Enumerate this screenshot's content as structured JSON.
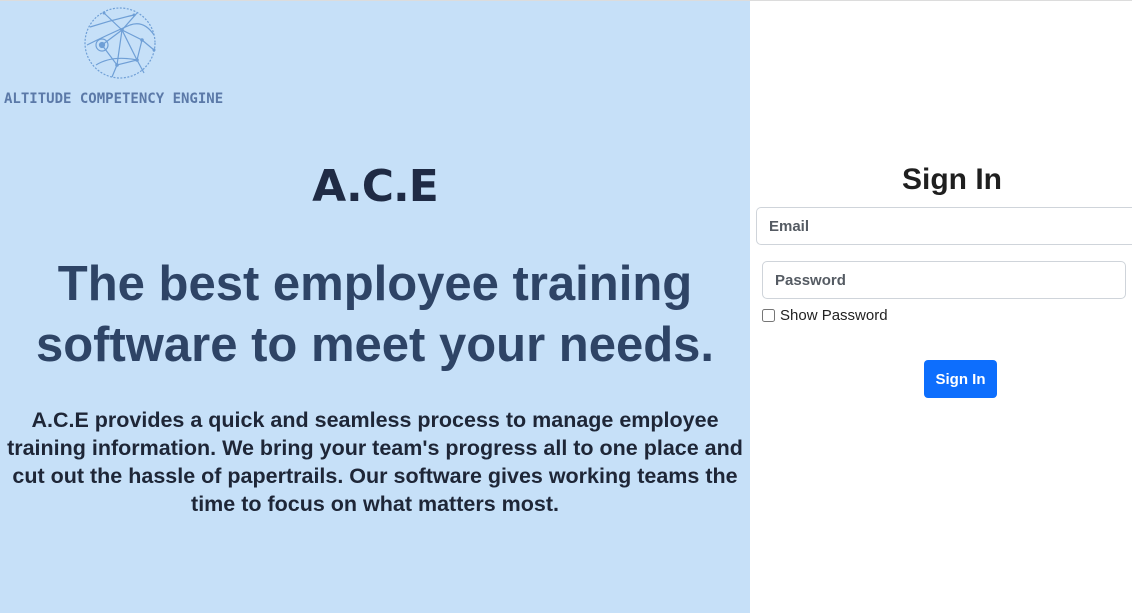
{
  "hero": {
    "logo_text": "ALTITUDE COMPETENCY ENGINE",
    "brand": "A.C.E",
    "headline_line1": "The best employee training",
    "headline_line2": "software to meet your needs.",
    "description_line1": "A.C.E provides a quick and seamless process to manage employee",
    "description_line2": "training information. We bring your team's progress all to one place and",
    "description_line3": "cut out the hassle of papertrails. Our software gives working teams the",
    "description_line4": "time to focus on what matters most.",
    "background_color": "#c6e0f8",
    "logo_icon": "globe-network-icon"
  },
  "signin": {
    "title": "Sign In",
    "email_placeholder": "Email",
    "password_placeholder": "Password",
    "show_password_label": "Show Password",
    "show_password_checked": false,
    "button_label": "Sign In",
    "button_color": "#0d6efd"
  }
}
